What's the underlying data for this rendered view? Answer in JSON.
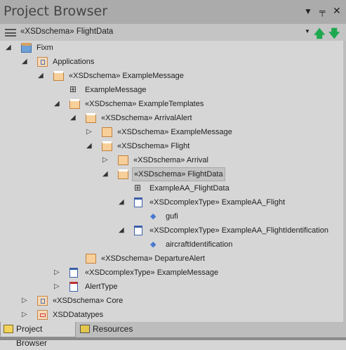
{
  "window": {
    "title": "Project Browser",
    "controls": [
      "dropdown-icon",
      "pin-icon",
      "close-icon"
    ]
  },
  "toolbar": {
    "breadcrumb": "«XSDschema» FlightData",
    "up_icon": "green-up-arrow-icon",
    "down_icon": "green-down-arrow-icon"
  },
  "tree": [
    {
      "level": 0,
      "label": "Fixm",
      "expander": "expanded",
      "icon": "model-root-icon"
    },
    {
      "level": 1,
      "label": "Applications",
      "expander": "expanded",
      "icon": "package-icon"
    },
    {
      "level": 2,
      "label": "«XSDschema» ExampleMessage",
      "expander": "expanded",
      "icon": "folder-open-icon"
    },
    {
      "level": 3,
      "label": "ExampleMessage",
      "expander": "none",
      "icon": "diagram-icon"
    },
    {
      "level": 3,
      "label": "«XSDschema» ExampleTemplates",
      "expander": "expanded",
      "icon": "folder-open-icon"
    },
    {
      "level": 4,
      "label": "«XSDschema» ArrivalAlert",
      "expander": "expanded",
      "icon": "folder-open-icon"
    },
    {
      "level": 5,
      "label": "«XSDschema» ExampleMessage",
      "expander": "collapsed",
      "icon": "folder-icon"
    },
    {
      "level": 5,
      "label": "«XSDschema» Flight",
      "expander": "expanded",
      "icon": "folder-open-icon"
    },
    {
      "level": 6,
      "label": "«XSDschema» Arrival",
      "expander": "collapsed",
      "icon": "folder-icon"
    },
    {
      "level": 6,
      "label": "«XSDschema» FlightData",
      "expander": "expanded",
      "icon": "folder-open-icon",
      "selected": true
    },
    {
      "level": 7,
      "label": "ExampleAA_FlightData",
      "expander": "none",
      "icon": "diagram-icon"
    },
    {
      "level": 7,
      "label": "«XSDcomplexType» ExampleAA_Flight",
      "expander": "expanded",
      "icon": "class-icon"
    },
    {
      "level": 8,
      "label": "gufi",
      "expander": "none",
      "icon": "attribute-icon"
    },
    {
      "level": 7,
      "label": "«XSDcomplexType» ExampleAA_FlightIdentification",
      "expander": "expanded",
      "icon": "class-icon"
    },
    {
      "level": 8,
      "label": "aircraftIdentification",
      "expander": "none",
      "icon": "attribute-icon"
    },
    {
      "level": 4,
      "label": "«XSDschema» DepartureAlert",
      "expander": "none",
      "icon": "folder-icon"
    },
    {
      "level": 3,
      "label": "«XSDcomplexType» ExampleMessage",
      "expander": "collapsed",
      "icon": "class-icon"
    },
    {
      "level": 3,
      "label": "AlertType",
      "expander": "collapsed",
      "icon": "enumeration-icon"
    },
    {
      "level": 1,
      "label": "«XSDschema» Core",
      "expander": "collapsed",
      "icon": "package-icon"
    },
    {
      "level": 1,
      "label": "XSDDatatypes",
      "expander": "collapsed",
      "icon": "package-red-icon"
    }
  ],
  "tabs": [
    {
      "label": "Project Browser",
      "active": true
    },
    {
      "label": "Resources",
      "active": false
    }
  ]
}
